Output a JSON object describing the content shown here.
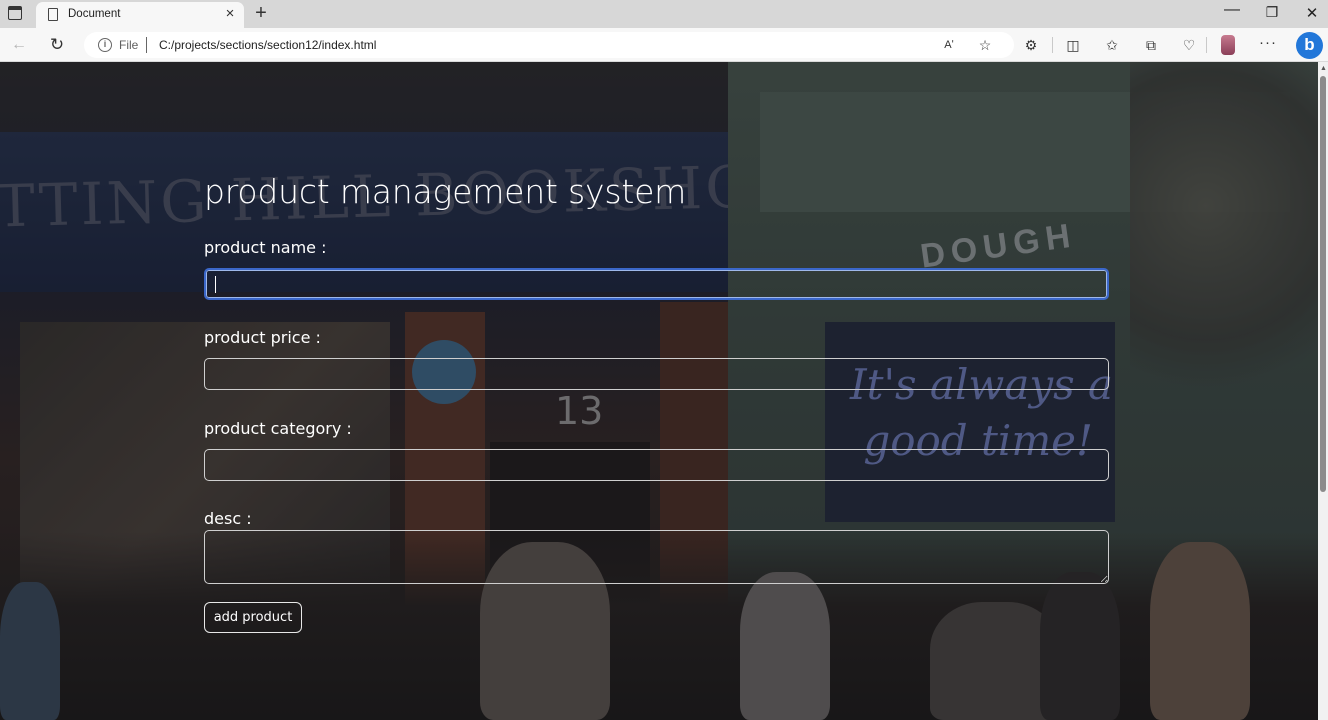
{
  "browser": {
    "tab_title": "Document",
    "tab_close_icon": "×",
    "new_tab_icon": "+",
    "window_controls": {
      "minimize": "—",
      "maximize": "❐",
      "close": "✕"
    },
    "nav": {
      "back": "←",
      "reload": "↻"
    },
    "address": {
      "scheme_label": "File",
      "url": "C:/projects/sections/section12/index.html"
    },
    "toolbar": {
      "read_aloud": "Aʹ",
      "favorite": "☆",
      "extensions": "⚙",
      "split": "◫",
      "favorites": "✩",
      "collections": "⧉",
      "health": "♡",
      "more": "···",
      "bing": "b"
    }
  },
  "page": {
    "title": "product management system",
    "fields": {
      "name": {
        "label": "product name :",
        "value": ""
      },
      "price": {
        "label": "product price :",
        "value": ""
      },
      "category": {
        "label": "product category :",
        "value": ""
      },
      "desc": {
        "label": "desc :",
        "value": ""
      }
    },
    "submit_label": "add product"
  }
}
